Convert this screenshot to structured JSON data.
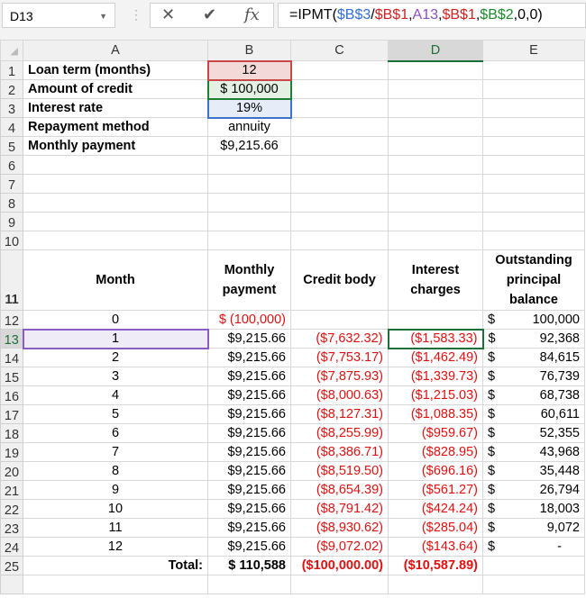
{
  "name_box": "D13",
  "formula_parts": [
    {
      "t": "=IPMT(",
      "c": "#000000"
    },
    {
      "t": "$B$3",
      "c": "#2f6fd6"
    },
    {
      "t": "/",
      "c": "#000000"
    },
    {
      "t": "$B$1",
      "c": "#d02020"
    },
    {
      "t": ",",
      "c": "#000000"
    },
    {
      "t": "A13",
      "c": "#8a4fc0"
    },
    {
      "t": ",",
      "c": "#000000"
    },
    {
      "t": "$B$1",
      "c": "#d02020"
    },
    {
      "t": ",",
      "c": "#000000"
    },
    {
      "t": "$B$2",
      "c": "#1a8a2a"
    },
    {
      "t": ",0,0)",
      "c": "#000000"
    }
  ],
  "columns": [
    "A",
    "B",
    "C",
    "D",
    "E"
  ],
  "params": [
    {
      "label": "Loan term (months)",
      "value": "12"
    },
    {
      "label": "Amount of credit",
      "value": "$  100,000"
    },
    {
      "label": "Interest rate",
      "value": "19%"
    },
    {
      "label": "Repayment method",
      "value": "annuity"
    },
    {
      "label": "Monthly payment",
      "value": "$9,215.66"
    }
  ],
  "table_headers": [
    "Month",
    "Monthly payment",
    "Credit body",
    "Interest charges",
    "Outstanding principal balance"
  ],
  "rows": [
    [
      "0",
      "$ (100,000)",
      "",
      "",
      "100,000"
    ],
    [
      "1",
      "$9,215.66",
      "($7,632.32)",
      "($1,583.33)",
      "92,368"
    ],
    [
      "2",
      "$9,215.66",
      "($7,753.17)",
      "($1,462.49)",
      "84,615"
    ],
    [
      "3",
      "$9,215.66",
      "($7,875.93)",
      "($1,339.73)",
      "76,739"
    ],
    [
      "4",
      "$9,215.66",
      "($8,000.63)",
      "($1,215.03)",
      "68,738"
    ],
    [
      "5",
      "$9,215.66",
      "($8,127.31)",
      "($1,088.35)",
      "60,611"
    ],
    [
      "6",
      "$9,215.66",
      "($8,255.99)",
      "($959.67)",
      "52,355"
    ],
    [
      "7",
      "$9,215.66",
      "($8,386.71)",
      "($828.95)",
      "43,968"
    ],
    [
      "8",
      "$9,215.66",
      "($8,519.50)",
      "($696.16)",
      "35,448"
    ],
    [
      "9",
      "$9,215.66",
      "($8,654.39)",
      "($561.27)",
      "26,794"
    ],
    [
      "10",
      "$9,215.66",
      "($8,791.42)",
      "($424.24)",
      "18,003"
    ],
    [
      "11",
      "$9,215.66",
      "($8,930.62)",
      "($285.04)",
      "9,072"
    ],
    [
      "12",
      "$9,215.66",
      "($9,072.02)",
      "($143.64)",
      "-"
    ]
  ],
  "currency_symbol": "$",
  "totals": {
    "label": "Total:",
    "payment": "$  110,588",
    "body": "($100,000.00)",
    "interest": "($10,587.89)"
  }
}
